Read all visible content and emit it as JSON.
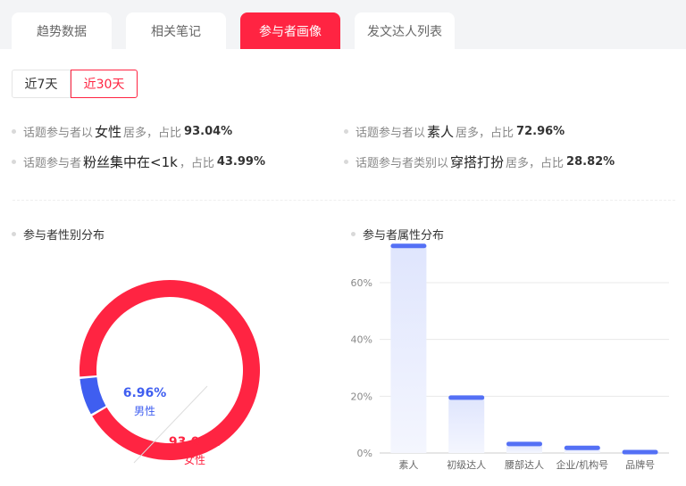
{
  "tabs": [
    {
      "label": "趋势数据",
      "active": false
    },
    {
      "label": "相关笔记",
      "active": false
    },
    {
      "label": "参与者画像",
      "active": true
    },
    {
      "label": "发文达人列表",
      "active": false
    }
  ],
  "range": {
    "option1": "近7天",
    "option2": "近30天",
    "selected": "近30天"
  },
  "insights": {
    "gender": {
      "prefix": "话题参与者以",
      "highlight": "女性",
      "suffix": "居多，占比",
      "pct": "93.04%"
    },
    "fans": {
      "prefix": "话题参与者",
      "highlight": "粉丝集中在<1k",
      "suffix": "，占比",
      "pct": "43.99%"
    },
    "attr": {
      "prefix": "话题参与者以",
      "highlight": "素人",
      "suffix": "居多，占比",
      "pct": "72.96%"
    },
    "category": {
      "prefix": "话题参与者类别以",
      "highlight": "穿搭打扮",
      "suffix": "居多，占比",
      "pct": "28.82%"
    }
  },
  "gender_title": "参与者性别分布",
  "attr_title": "参与者属性分布",
  "colors": {
    "brand": "#ff2442",
    "male": "#3f5ef0",
    "bar": "#5470f5"
  },
  "chart_data": [
    {
      "type": "pie",
      "title": "参与者性别分布",
      "slices": [
        {
          "name": "男性",
          "value": 6.96,
          "label": "6.96%"
        },
        {
          "name": "女性",
          "value": 93.04,
          "label": "93.04%"
        }
      ]
    },
    {
      "type": "bar",
      "title": "参与者属性分布",
      "categories": [
        "素人",
        "初级达人",
        "腰部达人",
        "企业/机构号",
        "品牌号"
      ],
      "values": [
        72.96,
        19.5,
        3.2,
        1.8,
        0.3
      ],
      "yticks": [
        "0%",
        "20%",
        "40%",
        "60%"
      ],
      "ylim": [
        0,
        80
      ],
      "grid": true
    }
  ]
}
